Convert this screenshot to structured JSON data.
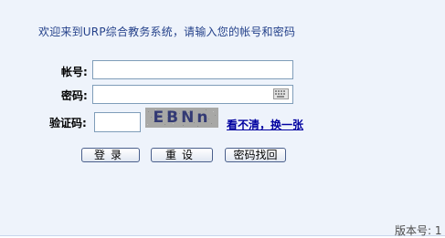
{
  "welcome": "欢迎来到URP综合教务系统，请输入您的帐号和密码",
  "form": {
    "username_label": "帐号:",
    "username_value": "",
    "password_label": "密码:",
    "password_value": "",
    "captcha_label": "验证码:",
    "captcha_value": "",
    "captcha_image_text": "EBNn",
    "refresh_link": "看不清，换一张",
    "keyboard_icon": "keyboard-icon"
  },
  "buttons": {
    "login": "登录",
    "reset": "重设",
    "recover": "密码找回"
  },
  "footer": {
    "version": "版本号: 1"
  },
  "colors": {
    "background": "#eef3fb",
    "welcome_text": "#24418a",
    "link": "#0000a0",
    "input_border": "#7f9db9",
    "button_border": "#4a5f8c"
  }
}
